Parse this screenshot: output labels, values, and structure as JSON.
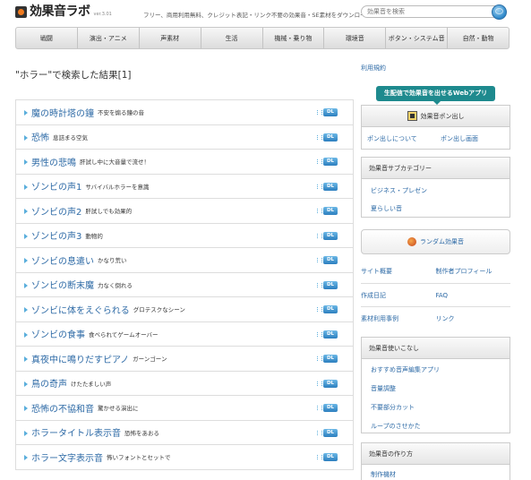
{
  "header": {
    "logo_text": "効果音ラボ",
    "version": "ver.3.01",
    "tagline": "フリー、商用利用無料、クレジット表記・リンク不要の効果音・SE素材をダウンロード",
    "search_placeholder": "効果音を検索"
  },
  "nav": {
    "items": [
      "戦闘",
      "演出・アニメ",
      "声素材",
      "生活",
      "機械・乗り物",
      "環境音",
      "ボタン・システム音",
      "自然・動物"
    ]
  },
  "main": {
    "result_title": "\"ホラー\"で検索した結果[1]",
    "download_label": "DL",
    "results": [
      {
        "title": "魔の時計塔の鐘",
        "desc": "不安を煽る鐘の音"
      },
      {
        "title": "恐怖",
        "desc": "息詰まる空気"
      },
      {
        "title": "男性の悲鳴",
        "desc": "肝試し中に大音量で流せ！"
      },
      {
        "title": "ゾンビの声1",
        "desc": "サバイバルホラーを意識"
      },
      {
        "title": "ゾンビの声2",
        "desc": "肝試しでも効果的"
      },
      {
        "title": "ゾンビの声3",
        "desc": "動物的"
      },
      {
        "title": "ゾンビの息遣い",
        "desc": "かなり荒い"
      },
      {
        "title": "ゾンビの断末魔",
        "desc": "力なく倒れる"
      },
      {
        "title": "ゾンビに体をえぐられる",
        "desc": "グロテスクなシーン"
      },
      {
        "title": "ゾンビの食事",
        "desc": "食べられてゲームオーバー"
      },
      {
        "title": "真夜中に鳴りだすピアノ",
        "desc": "ガーンゴーン"
      },
      {
        "title": "鳥の奇声",
        "desc": "けたたましい声"
      },
      {
        "title": "恐怖の不協和音",
        "desc": "驚かせる演出に"
      },
      {
        "title": "ホラータイトル表示音",
        "desc": "恐怖をあおる"
      },
      {
        "title": "ホラー文字表示音",
        "desc": "怖いフォントとセットで"
      }
    ]
  },
  "sidebar": {
    "terms": "利用規約",
    "banner": "生配信で効果音を出せるWebアプリ",
    "pon_title": "効果音ポン出し",
    "pon_links": [
      "ポン出しについて",
      "ポン出し画面"
    ],
    "subcat_title": "効果音サブカテゴリー",
    "subcat_links": [
      "ビジネス・プレゼン",
      "夏らしい音"
    ],
    "random": "ランダム効果音",
    "site_links": [
      "サイト概要",
      "制作者プロフィール",
      "作成日記",
      "FAQ",
      "素材利用事例",
      "リンク"
    ],
    "usage_title": "効果音使いこなし",
    "usage_links": [
      "おすすめ音声編集アプリ",
      "音量調整",
      "不要部分カット",
      "ループのさせかた"
    ],
    "make_title": "効果音の作り方",
    "make_links": [
      "制作機材"
    ]
  }
}
